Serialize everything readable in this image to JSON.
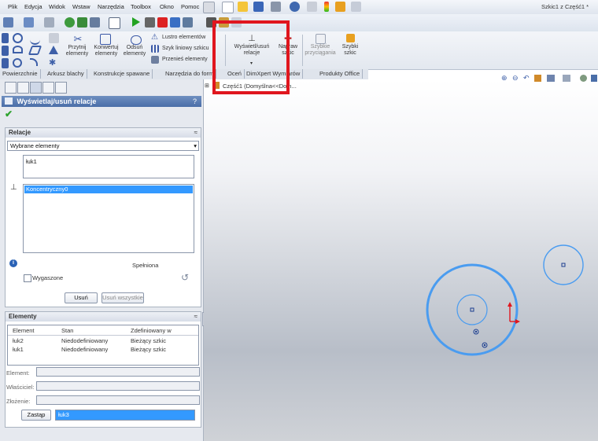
{
  "menu": {
    "items": [
      "Plik",
      "Edycja",
      "Widok",
      "Wstaw",
      "Narzędzia",
      "Toolbox",
      "Okno",
      "Pomoc"
    ],
    "window_title": "Szkic1 z Część1 *"
  },
  "ribbon": {
    "przytnij": "Przytnij elementy",
    "przytnij_l1": "Przytnij",
    "przytnij_l2": "elementy",
    "konwertuj_l1": "Konwertuj",
    "konwertuj_l2": "elementy",
    "odsun_l1": "Odsuń",
    "odsun_l2": "elementy",
    "lustro": "Lustro elementów",
    "szyk": "Szyk liniowy szkicu",
    "przenies": "Przenieś elementy",
    "wyswietl_l1": "Wyświetl/usuń",
    "wyswietl_l2": "relacje",
    "napraw_l1": "Napraw",
    "napraw_l2": "szkic",
    "przyciaganie_l1": "Szybkie",
    "przyciaganie_l2": "przyciągania",
    "szybki_l1": "Szybki",
    "szybki_l2": "szkic"
  },
  "tabs": [
    "Powierzchnie",
    "Arkusz blachy",
    "Konstrukcje spawane",
    "Narzędzia do form",
    "Oceń",
    "DimXpert Wymiarów",
    "Produkty Office"
  ],
  "panel": {
    "title": "Wyświetlaj/usuń relacje",
    "help": "?",
    "relacje": {
      "header": "Relacje",
      "filter": "Wybrane elementy",
      "selected_entity": "łuk1",
      "relation_item": "Koncentryczny0",
      "status": "Spełniona",
      "suppressed_label": "Wygaszone",
      "delete_btn": "Usuń",
      "delete_all_btn": "Usuń wszystkie"
    },
    "elementy": {
      "header": "Elementy",
      "columns": [
        "Element",
        "Stan",
        "Zdefiniowany w"
      ],
      "rows": [
        [
          "łuk2",
          "Niedodefiniowany",
          "Bieżący szkic"
        ],
        [
          "łuk1",
          "Niedodefiniowany",
          "Bieżący szkic"
        ]
      ],
      "element_label": "Element:",
      "owner_label": "Właściciel:",
      "assembly_label": "Złożenie:",
      "replace_btn": "Zastąp",
      "replace_value": "łuk3"
    }
  },
  "tree": {
    "root": "Część1  (Domyślna<<Dom..."
  },
  "colors": {
    "accent": "#e0161e",
    "selection": "#3399ff",
    "sketch": "#4a9cf0"
  }
}
